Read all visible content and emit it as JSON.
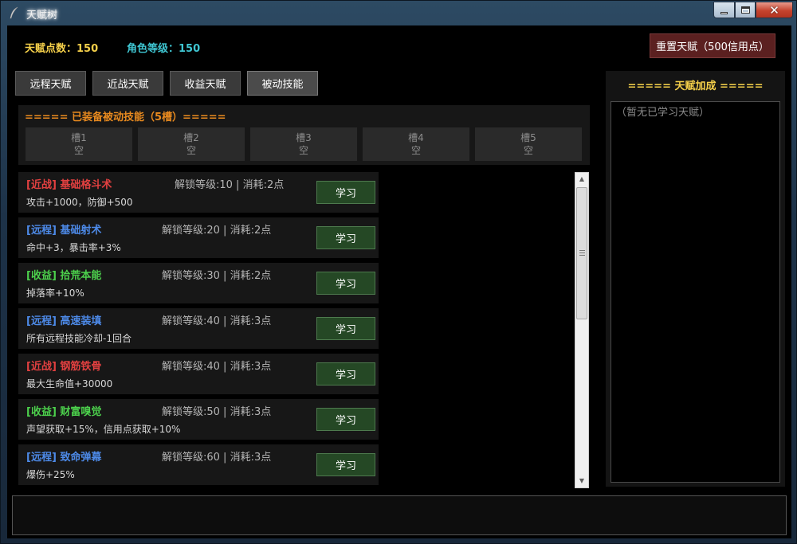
{
  "window": {
    "title": "天赋树"
  },
  "header": {
    "talent_points": "天赋点数：150",
    "character_level": "角色等级：150",
    "reset_button": "重置天赋（500信用点）"
  },
  "tabs": [
    {
      "label": "远程天赋",
      "active": false
    },
    {
      "label": "近战天赋",
      "active": false
    },
    {
      "label": "收益天赋",
      "active": false
    },
    {
      "label": "被动技能",
      "active": true
    }
  ],
  "equipped": {
    "title": "===== 已装备被动技能（5槽）=====",
    "slots": [
      {
        "name": "槽1",
        "value": "空"
      },
      {
        "name": "槽2",
        "value": "空"
      },
      {
        "name": "槽3",
        "value": "空"
      },
      {
        "name": "槽4",
        "value": "空"
      },
      {
        "name": "槽5",
        "value": "空"
      }
    ]
  },
  "talents": [
    {
      "tag": "[近战] 基础格斗术",
      "category": "melee",
      "req": "解锁等级:10 | 消耗:2点",
      "desc": "攻击+1000，防御+500",
      "button": "学习"
    },
    {
      "tag": "[远程] 基础射术",
      "category": "ranged",
      "req": "解锁等级:20 | 消耗:2点",
      "desc": "命中+3，暴击率+3%",
      "button": "学习"
    },
    {
      "tag": "[收益] 拾荒本能",
      "category": "income",
      "req": "解锁等级:30 | 消耗:2点",
      "desc": "掉落率+10%",
      "button": "学习"
    },
    {
      "tag": "[远程] 高速装填",
      "category": "ranged",
      "req": "解锁等级:40 | 消耗:3点",
      "desc": "所有远程技能冷却-1回合",
      "button": "学习"
    },
    {
      "tag": "[近战] 钢筋铁骨",
      "category": "melee",
      "req": "解锁等级:40 | 消耗:3点",
      "desc": "最大生命值+30000",
      "button": "学习"
    },
    {
      "tag": "[收益] 财富嗅觉",
      "category": "income",
      "req": "解锁等级:50 | 消耗:3点",
      "desc": "声望获取+15%，信用点获取+10%",
      "button": "学习"
    },
    {
      "tag": "[远程] 致命弹幕",
      "category": "ranged",
      "req": "解锁等级:60 | 消耗:3点",
      "desc": "爆伤+25%",
      "button": "学习"
    }
  ],
  "bonus_panel": {
    "title": "===== 天赋加成 =====",
    "empty_text": "（暂无已学习天赋）"
  },
  "colors": {
    "melee": "#e24040",
    "ranged": "#4d8ae8",
    "income": "#4cd04c",
    "gold": "#f5d04a",
    "cyan": "#3fc6d2",
    "orange": "#e88a1f"
  },
  "icons": {
    "title_icon": "feather-icon",
    "minimize": "minimize-icon",
    "maximize": "maximize-icon",
    "close": "close-icon"
  }
}
